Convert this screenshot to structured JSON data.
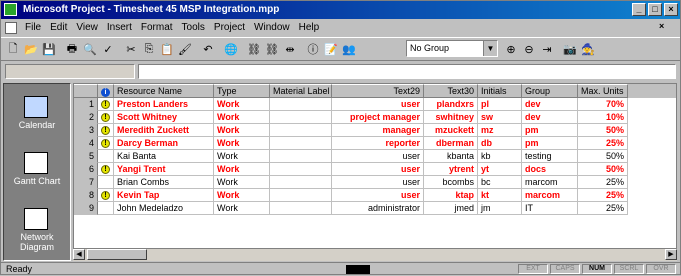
{
  "window": {
    "title": "Microsoft Project - Timesheet 45 MSP Integration.mpp",
    "controls": [
      "minimize",
      "maximize",
      "close"
    ]
  },
  "menubar": {
    "items": [
      "File",
      "Edit",
      "View",
      "Insert",
      "Format",
      "Tools",
      "Project",
      "Window",
      "Help"
    ]
  },
  "toolbar": {
    "group_select": "No Group"
  },
  "viewbar": {
    "items": [
      {
        "label": "Calendar",
        "icon": "calendar-icon"
      },
      {
        "label": "Gantt Chart",
        "icon": "gantt-chart-icon"
      },
      {
        "label": "Network Diagram",
        "icon": "network-diagram-icon"
      }
    ]
  },
  "grid": {
    "columns": [
      "",
      "i",
      "Resource Name",
      "Type",
      "Material Label",
      "Text29",
      "Text30",
      "Initials",
      "Group",
      "Max. Units"
    ],
    "rows": [
      {
        "num": "1",
        "overalloc": true,
        "name": "Preston Landers",
        "type": "Work",
        "material": "",
        "text29": "user",
        "text30": "plandxrs",
        "initials": "pl",
        "group": "dev",
        "max": "70%"
      },
      {
        "num": "2",
        "overalloc": true,
        "name": "Scott Whitney",
        "type": "Work",
        "material": "",
        "text29": "project manager",
        "text30": "swhitney",
        "initials": "sw",
        "group": "dev",
        "max": "10%"
      },
      {
        "num": "3",
        "overalloc": true,
        "name": "Meredith Zuckett",
        "type": "Work",
        "material": "",
        "text29": "manager",
        "text30": "mzuckett",
        "initials": "mz",
        "group": "pm",
        "max": "50%"
      },
      {
        "num": "4",
        "overalloc": true,
        "name": "Darcy Berman",
        "type": "Work",
        "material": "",
        "text29": "reporter",
        "text30": "dberman",
        "initials": "db",
        "group": "pm",
        "max": "25%"
      },
      {
        "num": "5",
        "overalloc": false,
        "name": "Kai Banta",
        "type": "Work",
        "material": "",
        "text29": "user",
        "text30": "kbanta",
        "initials": "kb",
        "group": "testing",
        "max": "50%"
      },
      {
        "num": "6",
        "overalloc": true,
        "name": "Yangi Trent",
        "type": "Work",
        "material": "",
        "text29": "user",
        "text30": "ytrent",
        "initials": "yt",
        "group": "docs",
        "max": "50%"
      },
      {
        "num": "7",
        "overalloc": false,
        "name": "Brian Combs",
        "type": "Work",
        "material": "",
        "text29": "user",
        "text30": "bcombs",
        "initials": "bc",
        "group": "marcom",
        "max": "25%"
      },
      {
        "num": "8",
        "overalloc": true,
        "name": "Kevin Tap",
        "type": "Work",
        "material": "",
        "text29": "user",
        "text30": "ktap",
        "initials": "kt",
        "group": "marcom",
        "max": "25%"
      },
      {
        "num": "9",
        "overalloc": false,
        "name": "John Medeladzo",
        "type": "Work",
        "material": "",
        "text29": "administrator",
        "text30": "jmed",
        "initials": "jm",
        "group": "IT",
        "max": "25%"
      }
    ]
  },
  "statusbar": {
    "text": "Ready",
    "indicators": [
      {
        "label": "EXT",
        "on": false
      },
      {
        "label": "CAPS",
        "on": false
      },
      {
        "label": "NUM",
        "on": true
      },
      {
        "label": "SCRL",
        "on": false
      },
      {
        "label": "OVR",
        "on": false
      }
    ]
  },
  "colors": {
    "overallocated_text": "#ff0000",
    "title_bar": "#000080",
    "indicator": "#e5e500"
  }
}
